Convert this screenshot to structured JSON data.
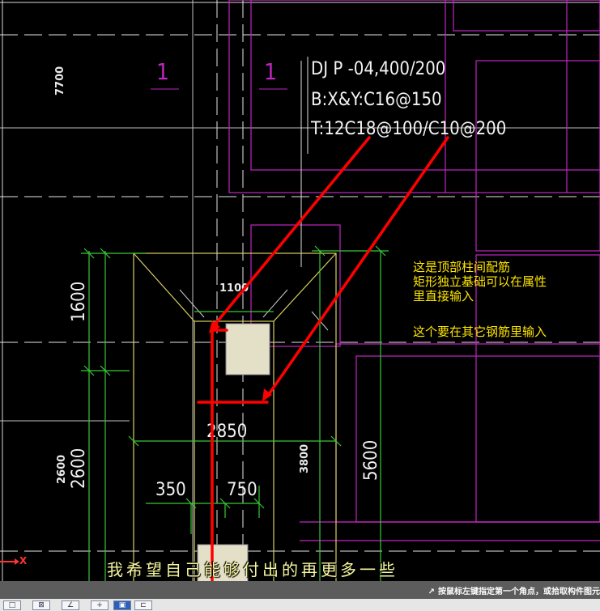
{
  "drawing": {
    "grid_dim_top": "7700",
    "axis_labels": [
      "1",
      "1"
    ],
    "foundation_label": {
      "line1": "DJ P -04,400/200",
      "line2": "B:X&Y:C16@150",
      "line3": "T:12C18@100/C10@200"
    },
    "dims": {
      "d1100": "1100",
      "d1600": "1600",
      "d2600a": "2600",
      "d2600b": "2600",
      "d2850": "2850",
      "d350": "350",
      "d750": "750",
      "d3800": "3800",
      "d5600": "5600"
    },
    "axis_x": "X"
  },
  "annotation": {
    "line1": "这是顶部柱间配筋",
    "line2": "矩形独立基础可以在属性",
    "line3": "里直接输入",
    "line4": "这个要在其它钢筋里输入"
  },
  "subtitle": "我希望自己能够付出的再更多一些",
  "status_bar": {
    "hint": "按鼠标左键指定第一个角点，或拾取构件图元"
  },
  "toolbar": {
    "buttons": [
      "□",
      "⊠",
      "∠",
      "+",
      "▣",
      "⊏"
    ]
  },
  "colors": {
    "background": "#000000",
    "magenta": "#c026c0",
    "yellow": "#d8d060",
    "green": "#38c838",
    "red": "#ff0000",
    "white": "#f0f0f0"
  }
}
